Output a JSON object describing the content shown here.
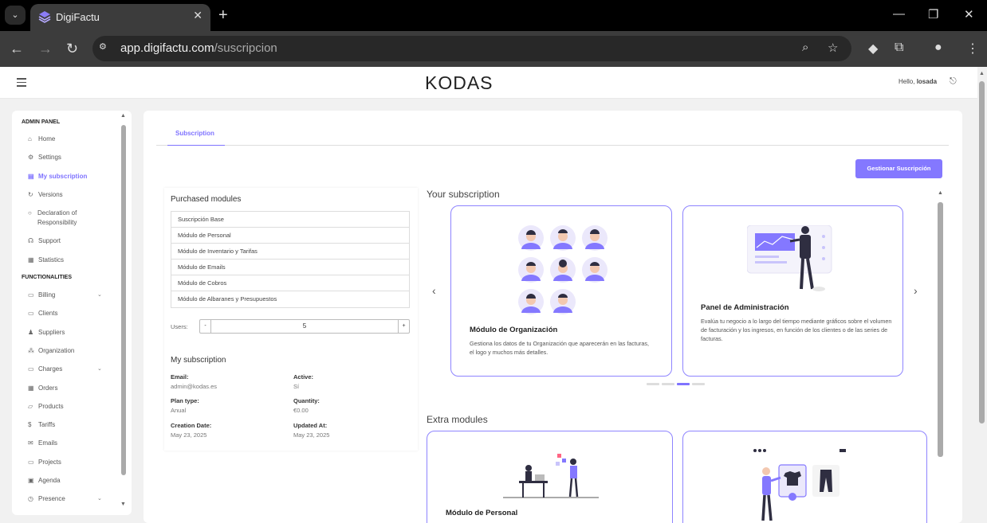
{
  "browser": {
    "tab_title": "DigiFactu",
    "url_host": "app.digifactu.com",
    "url_path": "/suscripcion"
  },
  "header": {
    "logo": "KODAS",
    "hello_prefix": "Hello,",
    "username": "losada"
  },
  "sidebar": {
    "sections": [
      {
        "title": "ADMIN PANEL"
      },
      {
        "title": "FUNCTIONALITIES"
      }
    ],
    "admin_items": [
      {
        "label": "Home",
        "icon": "home-icon",
        "glyph": "⌂"
      },
      {
        "label": "Settings",
        "icon": "gear-icon",
        "glyph": "⚙"
      },
      {
        "label": "My subscription",
        "icon": "document-icon",
        "glyph": "▤",
        "active": true
      },
      {
        "label": "Versions",
        "icon": "refresh-icon",
        "glyph": "↻"
      },
      {
        "label": "Declaration of Responsibility",
        "icon": "lightbulb-icon",
        "glyph": "○"
      },
      {
        "label": "Support",
        "icon": "headset-icon",
        "glyph": "☊"
      },
      {
        "label": "Statistics",
        "icon": "chart-icon",
        "glyph": "▦"
      }
    ],
    "func_items": [
      {
        "label": "Billing",
        "icon": "wallet-icon",
        "glyph": "▭",
        "chevron": true
      },
      {
        "label": "Clients",
        "icon": "id-card-icon",
        "glyph": "▭"
      },
      {
        "label": "Suppliers",
        "icon": "users-icon",
        "glyph": "♟"
      },
      {
        "label": "Organization",
        "icon": "org-icon",
        "glyph": "⁂"
      },
      {
        "label": "Charges",
        "icon": "credit-card-icon",
        "glyph": "▭",
        "chevron": true
      },
      {
        "label": "Orders",
        "icon": "grid-icon",
        "glyph": "▦"
      },
      {
        "label": "Products",
        "icon": "box-icon",
        "glyph": "▱"
      },
      {
        "label": "Tariffs",
        "icon": "dollar-icon",
        "glyph": "$"
      },
      {
        "label": "Emails",
        "icon": "mail-icon",
        "glyph": "✉"
      },
      {
        "label": "Projects",
        "icon": "folder-icon",
        "glyph": "▭"
      },
      {
        "label": "Agenda",
        "icon": "calendar-icon",
        "glyph": "▣"
      },
      {
        "label": "Presence",
        "icon": "clock-icon",
        "glyph": "◷",
        "chevron": true
      }
    ]
  },
  "main": {
    "tab": "Subscription",
    "manage_button": "Gestionar Suscripción",
    "purchased_title": "Purchased modules",
    "modules": [
      "Suscripción Base",
      "Módulo de Personal",
      "Módulo de Inventario y Tarifas",
      "Módulo de Emails",
      "Módulo de Cobros",
      "Módulo de Albaranes y Presupuestos"
    ],
    "users_label": "Users:",
    "users_value": "5",
    "minus": "-",
    "plus": "+",
    "my_subscription_title": "My subscription",
    "fields": [
      {
        "key": "Email:",
        "value": "admin@kodas.es"
      },
      {
        "key": "Active:",
        "value": "Sí"
      },
      {
        "key": "Plan type:",
        "value": "Anual"
      },
      {
        "key": "Quantity:",
        "value": "€0.00"
      },
      {
        "key": "Creation Date:",
        "value": "May 23, 2025"
      },
      {
        "key": "Updated At:",
        "value": "May 23, 2025"
      }
    ],
    "your_subscription_title": "Your subscription",
    "cards": [
      {
        "title": "Módulo de Organización",
        "desc": "Gestiona los datos de tu Organización que aparecerán en las facturas, el logo y muchos más detalles."
      },
      {
        "title": "Panel de Administración",
        "desc": "Evalúa tu negocio a lo largo del tiempo mediante gráficos sobre el volumen de facturación y los ingresos, en función de los clientes o de las series de facturas."
      }
    ],
    "carousel_active_dot": 3,
    "carousel_dot_count": 4,
    "extra_title": "Extra modules",
    "extra_cards": [
      {
        "title": "Módulo de Personal"
      },
      {
        "title": ""
      }
    ]
  },
  "colors": {
    "accent": "#7f73ff",
    "card_border": "#8e84ff"
  }
}
